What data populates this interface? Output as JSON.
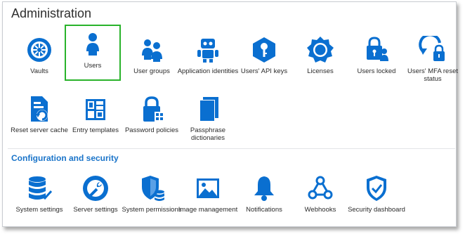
{
  "page": {
    "title": "Administration"
  },
  "administration": {
    "items": [
      {
        "label": "Vaults",
        "icon": "vault-icon"
      },
      {
        "label": "Users",
        "icon": "user-icon",
        "selected": true
      },
      {
        "label": "User groups",
        "icon": "user-group-icon"
      },
      {
        "label": "Application identities",
        "icon": "robot-icon"
      },
      {
        "label": "Users' API keys",
        "icon": "api-key-icon"
      },
      {
        "label": "Licenses",
        "icon": "license-icon"
      },
      {
        "label": "Users locked",
        "icon": "user-locked-icon"
      },
      {
        "label": "Users' MFA reset status",
        "icon": "mfa-reset-icon"
      },
      {
        "label": "Reset server cache",
        "icon": "reset-cache-icon"
      },
      {
        "label": "Entry templates",
        "icon": "entry-templates-icon"
      },
      {
        "label": "Password policies",
        "icon": "password-policy-icon"
      },
      {
        "label": "Passphrase dictionaries",
        "icon": "dictionary-icon"
      }
    ]
  },
  "config": {
    "title": "Configuration and security",
    "items": [
      {
        "label": "System settings",
        "icon": "system-settings-icon"
      },
      {
        "label": "Server settings",
        "icon": "server-settings-icon"
      },
      {
        "label": "System permissions",
        "icon": "system-permissions-icon"
      },
      {
        "label": "Image management",
        "icon": "image-icon"
      },
      {
        "label": "Notifications",
        "icon": "bell-icon"
      },
      {
        "label": "Webhooks",
        "icon": "webhook-icon"
      },
      {
        "label": "Security dashboard",
        "icon": "shield-check-icon"
      }
    ]
  },
  "colors": {
    "icon": "#0a6fd0",
    "accent": "#1a74c9",
    "selection": "#29b32b"
  }
}
